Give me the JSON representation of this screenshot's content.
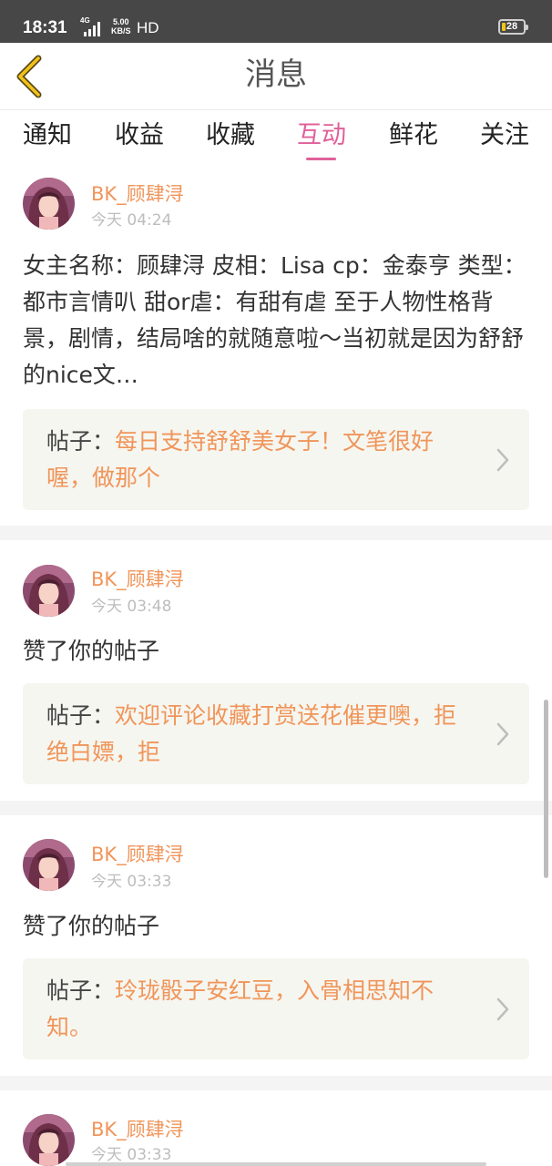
{
  "status_bar": {
    "time": "18:31",
    "network": "4G",
    "speed_value": "5.00",
    "speed_unit": "KB/S",
    "hd": "HD",
    "battery": "28"
  },
  "header": {
    "title": "消息",
    "back_icon": "chevron-left-icon"
  },
  "tabs": [
    {
      "label": "通知",
      "active": false
    },
    {
      "label": "收益",
      "active": false
    },
    {
      "label": "收藏",
      "active": false
    },
    {
      "label": "互动",
      "active": true
    },
    {
      "label": "鲜花",
      "active": false
    },
    {
      "label": "关注",
      "active": false
    }
  ],
  "colors": {
    "accent_pink": "#e0609a",
    "accent_orange": "#f0955a",
    "status_bar_bg": "#474747",
    "post_box_bg": "#f6f6f0"
  },
  "items": [
    {
      "username": "BK_顾肆浔",
      "time": "今天 04:24",
      "message": "女主名称：顾肆浔 皮相：Lisa cp：金泰亨 类型：都市言情叭 甜or虐：有甜有虐 至于人物性格背景，剧情，结局啥的就随意啦～当初就是因为舒舒的nice文…",
      "post_label": "帖子：",
      "post_title": "每日支持舒舒美女子！文笔很好喔，做那个"
    },
    {
      "username": "BK_顾肆浔",
      "time": "今天 03:48",
      "message": "赞了你的帖子",
      "post_label": "帖子：",
      "post_title": "欢迎评论收藏打赏送花催更噢，拒绝白嫖，拒"
    },
    {
      "username": "BK_顾肆浔",
      "time": "今天 03:33",
      "message": "赞了你的帖子",
      "post_label": "帖子：",
      "post_title": "玲珑骰子安红豆，入骨相思知不知。"
    },
    {
      "username": "BK_顾肆浔",
      "time": "今天 03:33"
    }
  ]
}
